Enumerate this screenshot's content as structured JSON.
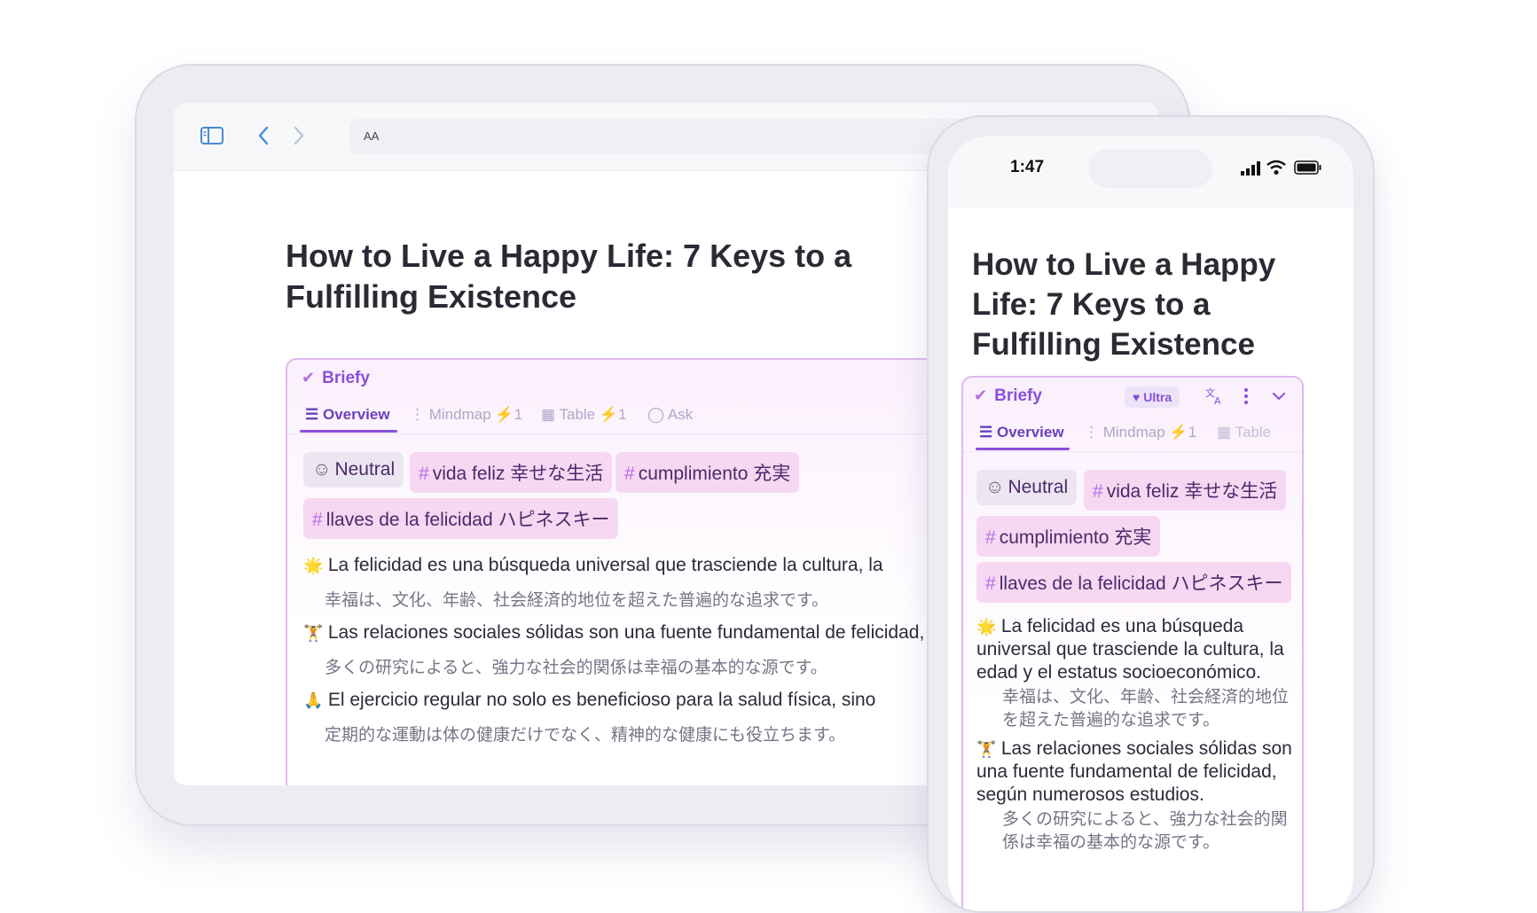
{
  "tablet": {
    "toolbar": {
      "sidebar_icon": "sidebar-toggle-icon",
      "back_icon": "chevron-left-icon",
      "forward_icon": "chevron-right-icon",
      "address_text_size": "AA"
    },
    "article_title": "How to Live a Happy Life: 7 Keys to a Fulfilling Existence",
    "briefy": {
      "brand": "Briefy",
      "tabs": [
        {
          "label": "Overview",
          "icon": "list-icon",
          "active": true
        },
        {
          "label": "Mindmap",
          "icon": "mindmap-icon",
          "bolt_count": "1"
        },
        {
          "label": "Table",
          "icon": "table-icon",
          "bolt_count": "1"
        },
        {
          "label": "Ask",
          "icon": "chat-icon"
        }
      ],
      "tags": {
        "sentiment": "Neutral",
        "tag1": "vida feliz 幸せな生活",
        "tag2": "cumplimiento 充実",
        "tag3": "llaves de la felicidad ハピネスキー"
      },
      "points": [
        {
          "emoji": "🌟",
          "es": "La felicidad es una búsqueda universal que trasciende la cultura, la",
          "ja": "幸福は、文化、年齢、社会経済的地位を超えた普遍的な追求です。"
        },
        {
          "emoji": "🏋",
          "es": "Las relaciones sociales sólidas son una fuente fundamental de felicidad,",
          "ja": "多くの研究によると、強力な社会的関係は幸福の基本的な源です。"
        },
        {
          "emoji": "🙏",
          "es": "El ejercicio regular no solo es beneficioso para la salud física, sino",
          "ja": "定期的な運動は体の健康だけでなく、精神的な健康にも役立ちます。"
        }
      ]
    }
  },
  "phone": {
    "status": {
      "time": "1:47"
    },
    "article_title": "How to Live a Happy Life: 7 Keys to a Fulfilling Existence",
    "briefy": {
      "brand": "Briefy",
      "badge": "Ultra",
      "tabs": [
        {
          "label": "Overview",
          "active": true
        },
        {
          "label": "Mindmap",
          "bolt_count": "1"
        },
        {
          "label": "Table"
        }
      ],
      "tags": {
        "sentiment": "Neutral",
        "tag1": "vida feliz 幸せな生活",
        "tag2": "cumplimiento 充実",
        "tag3": "llaves de la felicidad ハピネスキー"
      },
      "point1_es": "La felicidad es una búsqueda universal que trasciende la cultura, la edad y el estatus socioeconómico.",
      "point1_ja": "幸福は、文化、年齢、社会経済的地位を超えた普遍的な追求です。",
      "point2_es": "Las relaciones sociales sólidas son una fuente fundamental de felicidad, según numerosos estudios.",
      "point2_ja": "多くの研究によると、強力な社会的関係は幸福の基本的な源です。"
    }
  },
  "colors": {
    "accent": "#8a4fd8",
    "chip_bg": "#f6d8f3",
    "browser_blue": "#4a8ad8"
  }
}
